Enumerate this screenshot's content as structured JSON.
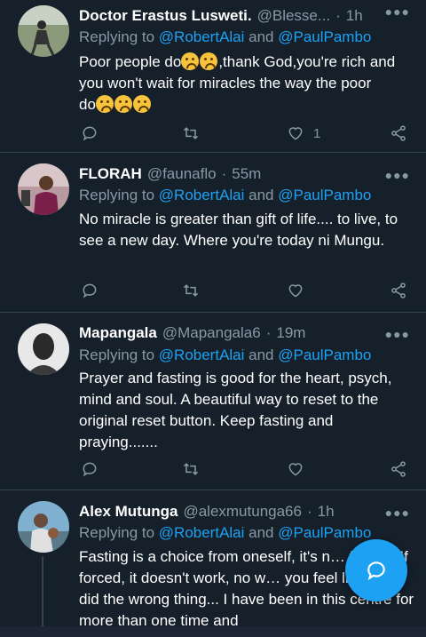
{
  "tweets": [
    {
      "name": "Doctor Erastus Lusweti.",
      "handle": "@Blesse...",
      "time": "1h",
      "replying_prefix": "Replying to ",
      "mention1": "@RobertAlai",
      "and": " and ",
      "mention2": "@PaulPambo",
      "text_line1_a": "Poor people do",
      "text_line1_b": ",thank God,you're rich and",
      "text_line2": "you won't wait for miracles the way the poor",
      "text_line3": "do",
      "likes": "1",
      "avatar_icon": "avatar-icon"
    },
    {
      "name": "FLORAH",
      "handle": "@faunaflo",
      "time": "55m",
      "replying_prefix": "Replying to ",
      "mention1": "@RobertAlai",
      "and": " and ",
      "mention2": "@PaulPambo",
      "text": "No miracle is greater than gift of life.... to live, to see a new day. Where you're today ni Mungu."
    },
    {
      "name": "Mapangala",
      "handle": "@Mapangala6",
      "time": "19m",
      "replying_prefix": "Replying to ",
      "mention1": "@RobertAlai",
      "and": " and ",
      "mention2": "@PaulPambo",
      "text": "Prayer and fasting is good for the heart, psych, mind and soul. A beautiful way to reset to the original reset button. Keep fasting and praying......."
    },
    {
      "name": "Alex Mutunga",
      "handle": "@alexmutunga66",
      "time": "1h",
      "replying_prefix": "Replying to ",
      "mention1": "@RobertAlai",
      "and": " and ",
      "mention2": "@PaulPambo",
      "text": "Fasting is a choice from oneself, it's n… forced.  If forced, it doesn't work, no w… you feel like you did the wrong thing...  I have been in this centre for more than one time and"
    }
  ],
  "separator": "·",
  "more_glyph": "●●●",
  "colors": {
    "background": "#15202b",
    "secondary_text": "#8899a6",
    "accent": "#1da1f2",
    "divider": "#38444d"
  }
}
